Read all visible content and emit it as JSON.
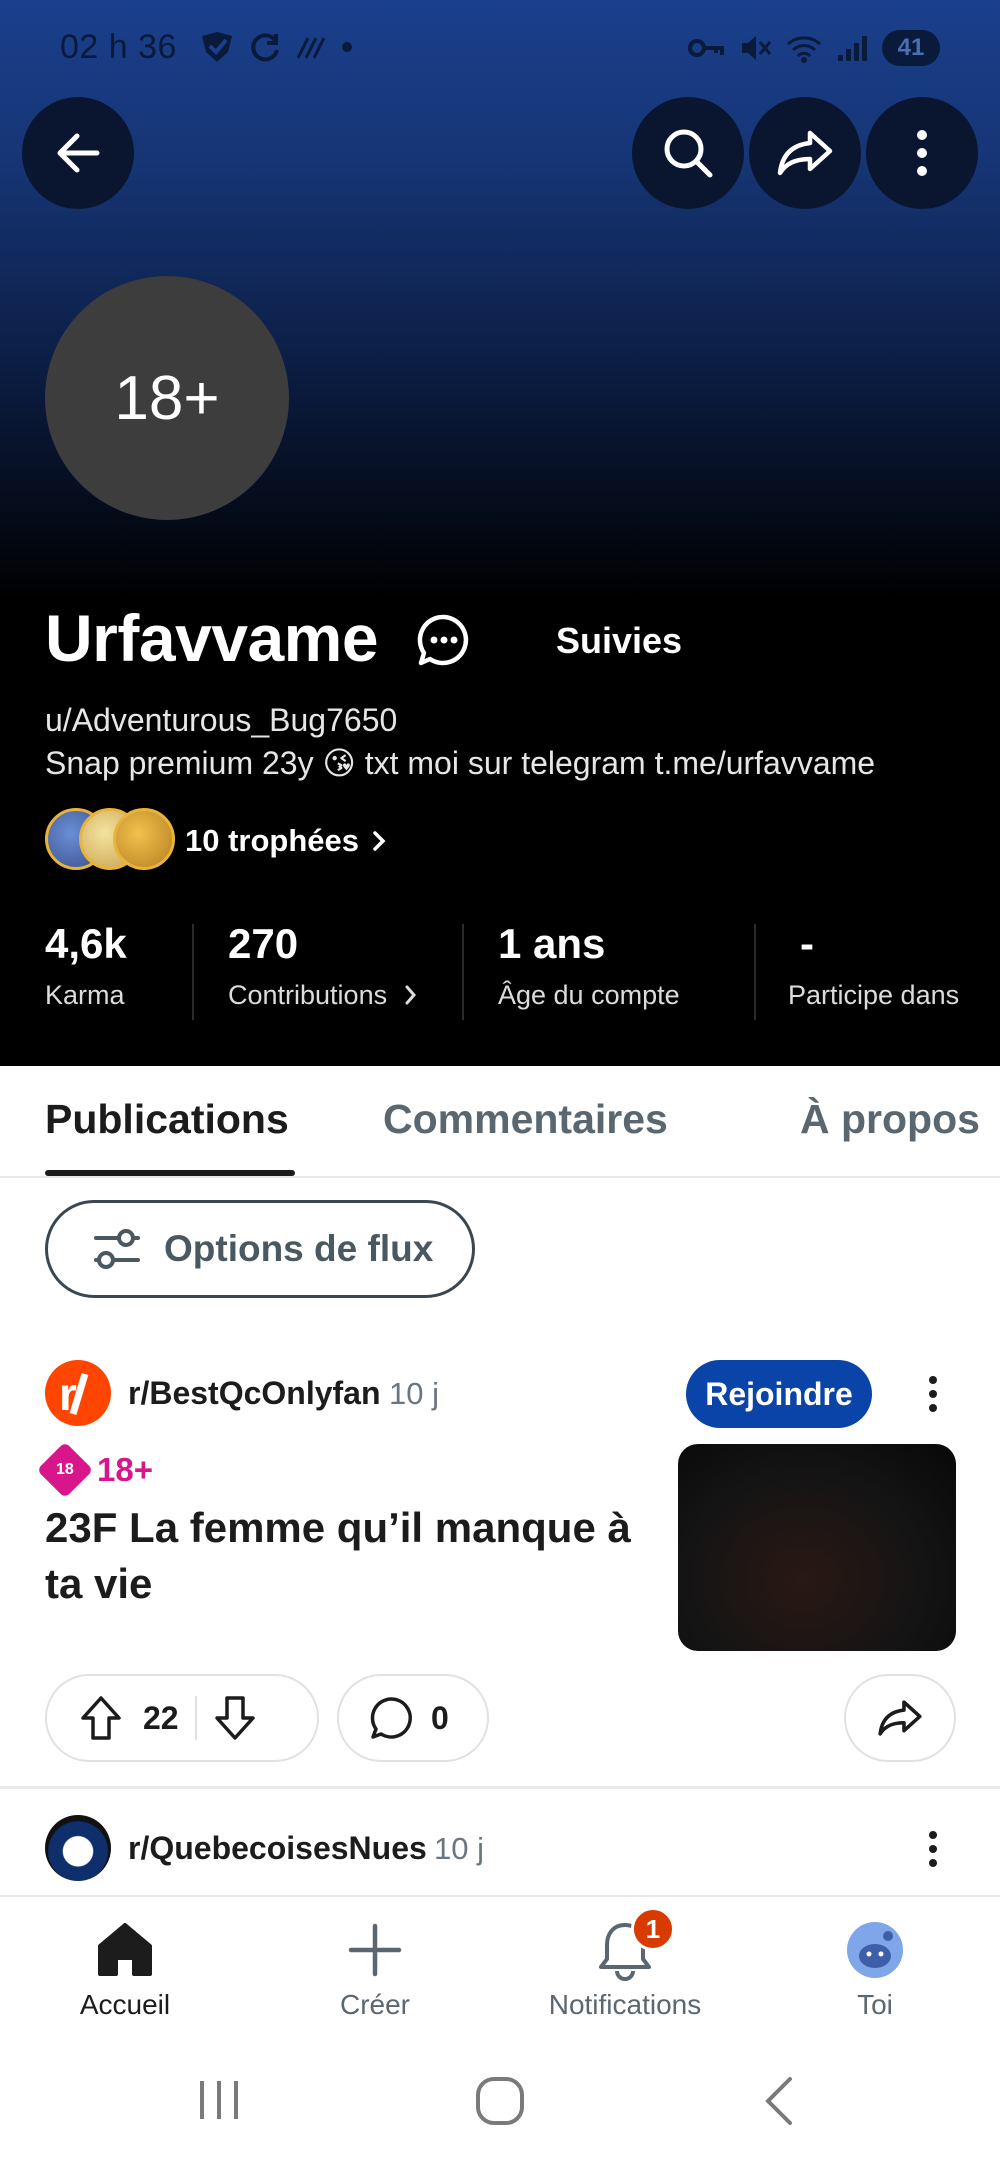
{
  "status_bar": {
    "time": "02 h 36",
    "battery": "41"
  },
  "profile": {
    "avatar_text": "18+",
    "display_name": "Urfavvame",
    "follow_status": "Suivies",
    "username": "u/Adventurous_Bug7650",
    "bio": "Snap premium 23y 😘 txt moi sur telegram t.me/urfavvame",
    "trophies_label": "10 trophées"
  },
  "stats": [
    {
      "value": "4,6k",
      "label": "Karma"
    },
    {
      "value": "270",
      "label": "Contributions"
    },
    {
      "value": "1 ans",
      "label": "Âge du compte"
    },
    {
      "value": "-",
      "label": "Participe dans"
    }
  ],
  "tabs": [
    {
      "label": "Publications",
      "active": true
    },
    {
      "label": "Commentaires",
      "active": false
    },
    {
      "label": "À propos",
      "active": false
    }
  ],
  "feed_options_label": "Options de flux",
  "posts": [
    {
      "subreddit": "r/BestQcOnlyfan",
      "age": "10 j",
      "join_label": "Rejoindre",
      "nsfw_badge": "18",
      "nsfw_label": "18+",
      "title": "23F La femme qu’il manque à ta vie",
      "upvotes": "22",
      "comments": "0"
    },
    {
      "subreddit": "r/QuebecoisesNues",
      "age": "10 j"
    }
  ],
  "bottom_nav": [
    {
      "label": "Accueil",
      "icon": "home-icon",
      "active": true
    },
    {
      "label": "Créer",
      "icon": "plus-icon",
      "active": false
    },
    {
      "label": "Notifications",
      "icon": "bell-icon",
      "active": false,
      "badge": "1"
    },
    {
      "label": "Toi",
      "icon": "user-avatar-icon",
      "active": false
    }
  ],
  "colors": {
    "join_button": "#0b44a8",
    "nsfw": "#d8168c",
    "notification_badge": "#d93a00",
    "subreddit_icon": "#ff4500"
  }
}
